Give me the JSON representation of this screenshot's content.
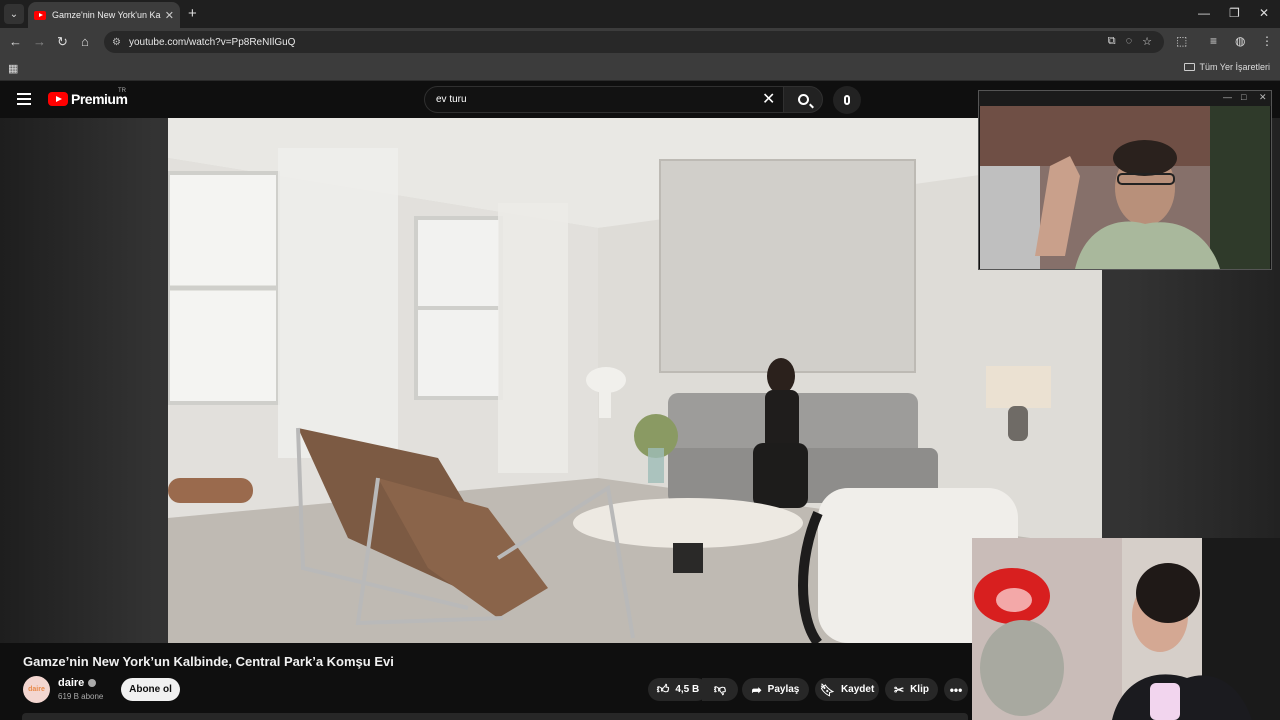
{
  "browser": {
    "tab_title": "Gamze'nin New York'un Kalbinde",
    "url": "youtube.com/watch?v=Pp8ReNIlGuQ",
    "bookmarks_all": "Tüm Yer İşaretleri"
  },
  "youtube": {
    "logo_text": "Premium",
    "logo_region": "TR",
    "search_value": "ev turu"
  },
  "video": {
    "title": "Gamze’nin New York’un Kalbinde, Central Park’a Komşu Evi",
    "channel_name": "daire",
    "channel_avatar_text": "daire",
    "subscribers": "619 B abone",
    "subscribe_label": "Abone ol",
    "likes": "4,5 B",
    "share_label": "Paylaş",
    "save_label": "Kaydet",
    "clip_label": "Klip"
  },
  "icons": {
    "tab_search": "chevron-down-icon",
    "favicon": "youtube-icon",
    "more": "more-horizontal-icon"
  },
  "colors": {
    "youtube_red": "#ff0000",
    "background": "#0f0f0f",
    "pill": "#272727"
  }
}
